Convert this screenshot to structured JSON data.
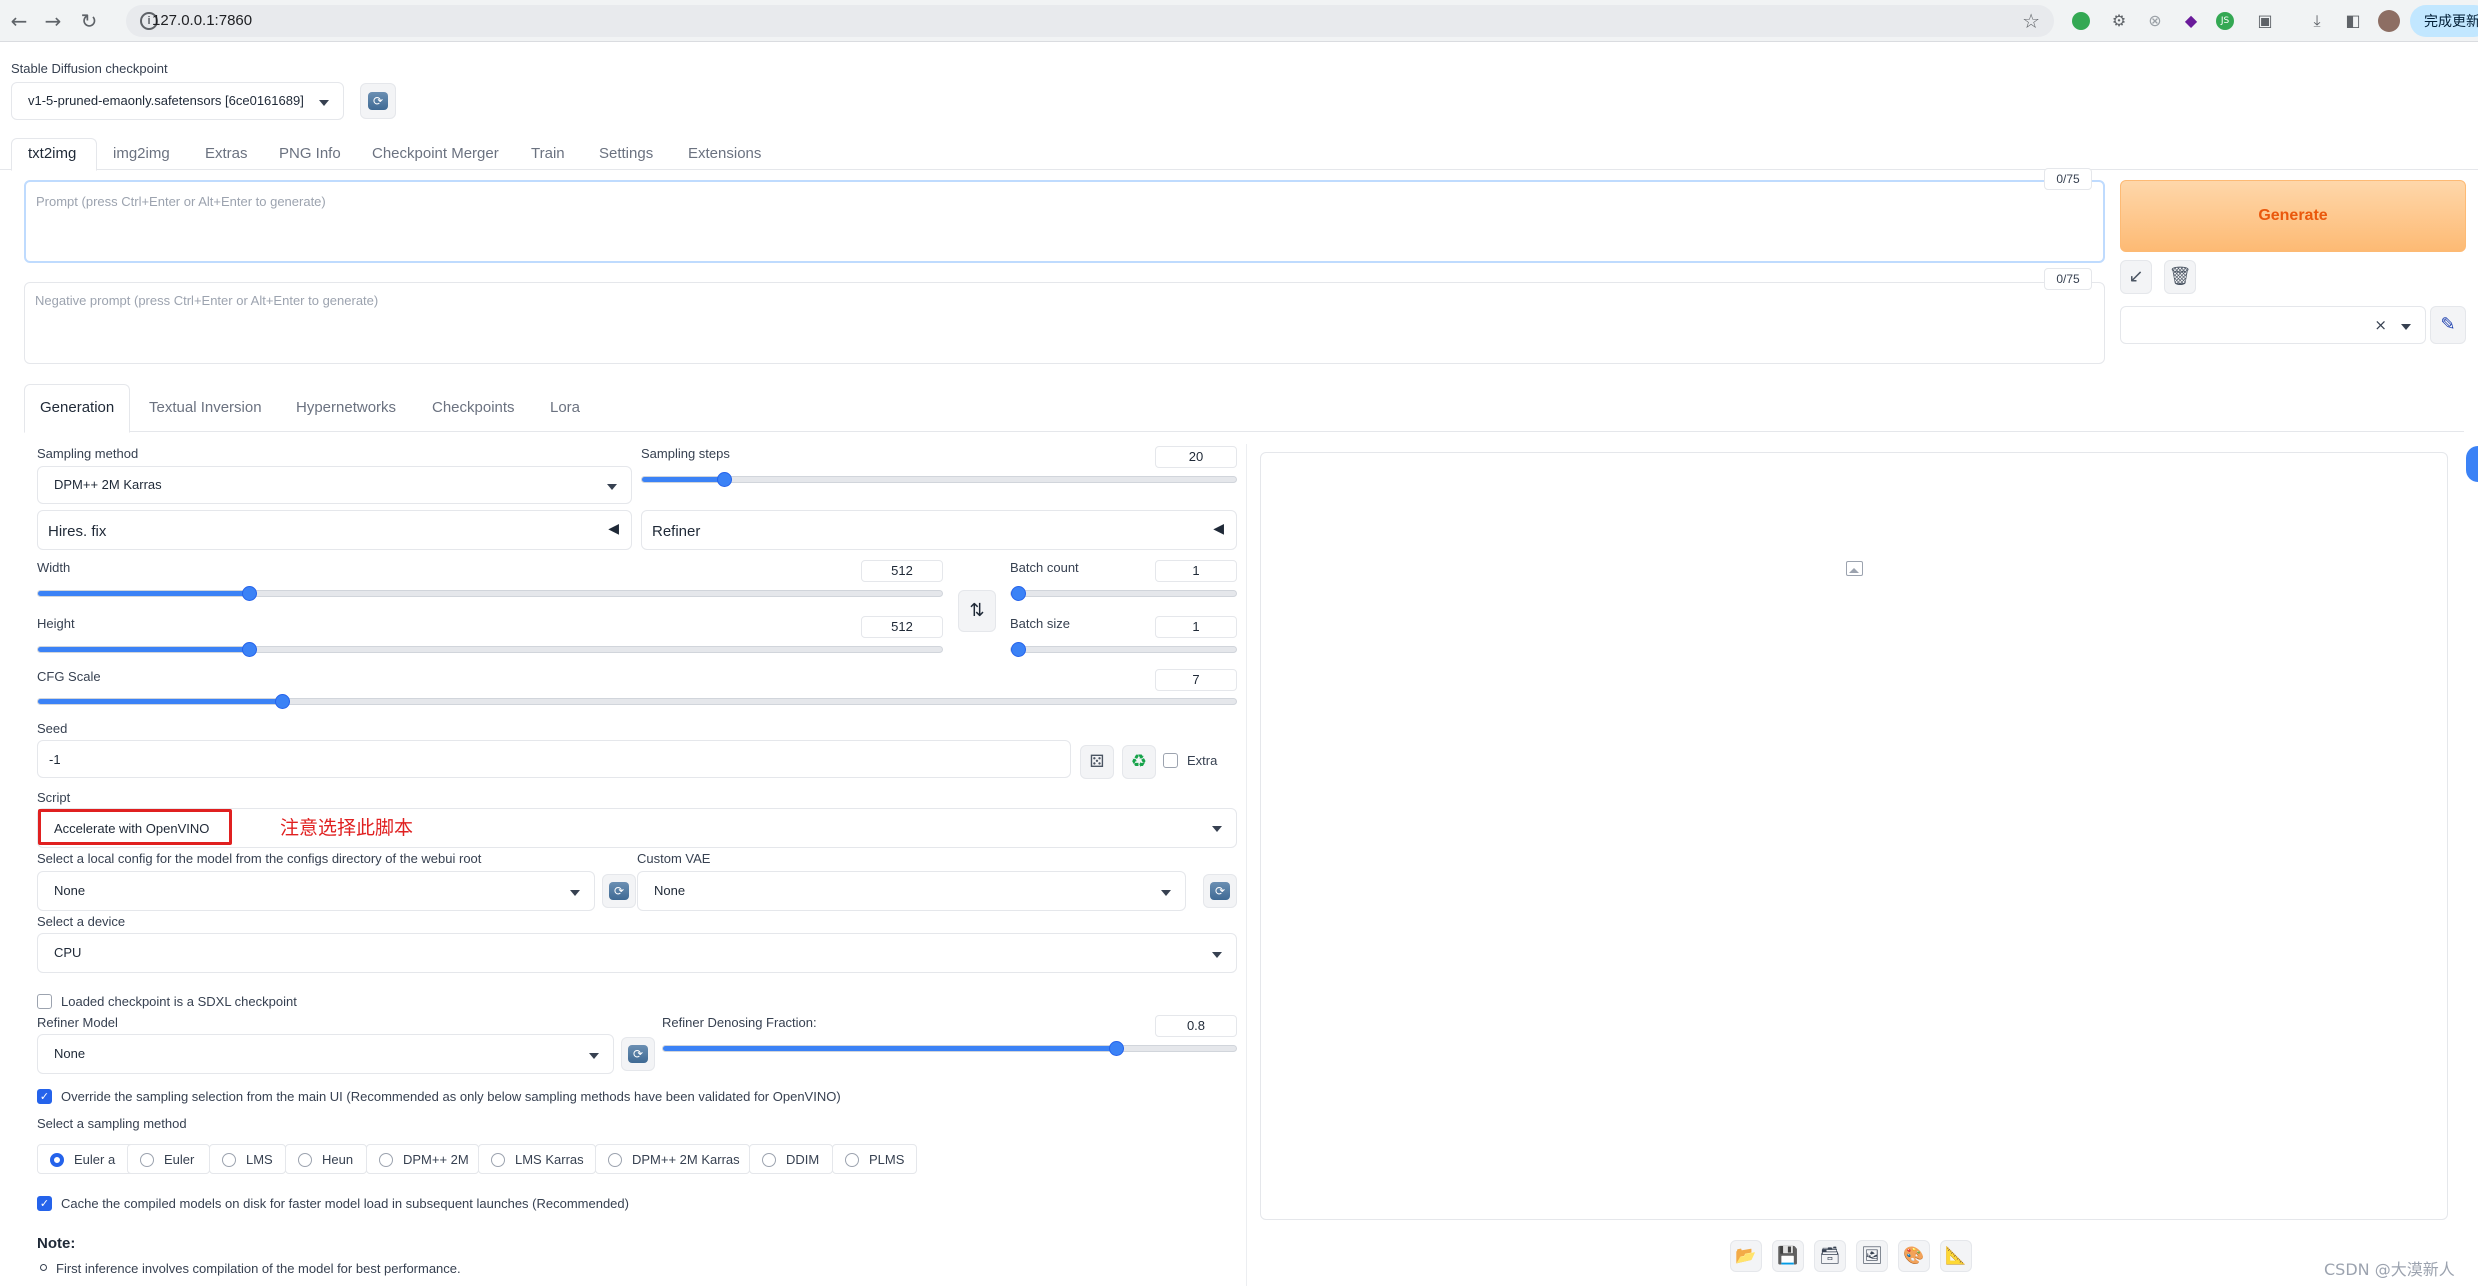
{
  "browser": {
    "url": "127.0.0.1:7860",
    "update_button": "完成更新"
  },
  "checkpoint": {
    "label": "Stable Diffusion checkpoint",
    "value": "v1-5-pruned-emaonly.safetensors [6ce0161689]"
  },
  "main_tabs": [
    "txt2img",
    "img2img",
    "Extras",
    "PNG Info",
    "Checkpoint Merger",
    "Train",
    "Settings",
    "Extensions"
  ],
  "prompt": {
    "placeholder": "Prompt (press Ctrl+Enter or Alt+Enter to generate)",
    "counter": "0/75"
  },
  "negative_prompt": {
    "placeholder": "Negative prompt (press Ctrl+Enter or Alt+Enter to generate)",
    "counter": "0/75"
  },
  "generate_label": "Generate",
  "sub_tabs": [
    "Generation",
    "Textual Inversion",
    "Hypernetworks",
    "Checkpoints",
    "Lora"
  ],
  "sampling": {
    "method_label": "Sampling method",
    "method_value": "DPM++ 2M Karras",
    "steps_label": "Sampling steps",
    "steps_value": "20",
    "steps_fraction": 0.13
  },
  "hires_label": "Hires. fix",
  "refiner_label": "Refiner",
  "width": {
    "label": "Width",
    "value": "512",
    "fraction": 0.23
  },
  "height": {
    "label": "Height",
    "value": "512",
    "fraction": 0.23
  },
  "batch_count": {
    "label": "Batch count",
    "value": "1",
    "fraction": 0.0
  },
  "batch_size": {
    "label": "Batch size",
    "value": "1",
    "fraction": 0.0
  },
  "cfg": {
    "label": "CFG Scale",
    "value": "7",
    "fraction": 0.2
  },
  "seed": {
    "label": "Seed",
    "value": "-1",
    "extra_label": "Extra"
  },
  "script": {
    "label": "Script",
    "value": "Accelerate with OpenVINO",
    "annotation": "注意选择此脚本"
  },
  "openvino": {
    "config_label": "Select a local config for the model from the configs directory of the webui root",
    "config_value": "None",
    "vae_label": "Custom VAE",
    "vae_value": "None",
    "device_label": "Select a device",
    "device_value": "CPU",
    "sdxl_label": "Loaded checkpoint is a SDXL checkpoint",
    "refiner_model_label": "Refiner Model",
    "refiner_model_value": "None",
    "denoise_label": "Refiner Denosing Fraction:",
    "denoise_value": "0.8",
    "denoise_fraction": 0.8,
    "override_label": "Override the sampling selection from the main UI (Recommended as only below sampling methods have been validated for OpenVINO)",
    "sampler_label": "Select a sampling method",
    "samplers": [
      "Euler a",
      "Euler",
      "LMS",
      "Heun",
      "DPM++ 2M",
      "LMS Karras",
      "DPM++ 2M Karras",
      "DDIM",
      "PLMS"
    ],
    "selected_sampler": "Euler a",
    "cache_label": "Cache the compiled models on disk for faster model load in subsequent launches (Recommended)",
    "note_title": "Note:",
    "note_item": "First inference involves compilation of the model for best performance."
  },
  "watermark": "CSDN @大漠新人",
  "colors": {
    "generate_gradient_start": "#fed7aa",
    "generate_gradient_end": "#fdba74",
    "generate_text": "#ea580c",
    "accent": "#3b82f6",
    "annotation_red": "#e02020"
  }
}
